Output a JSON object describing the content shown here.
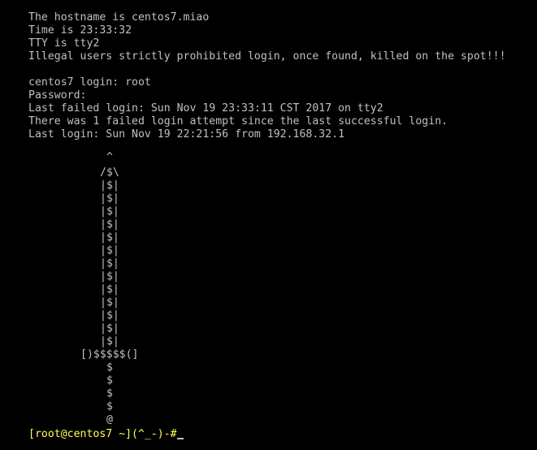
{
  "banner": {
    "hostname_line": "The hostname is centos7.miao",
    "time_line": "Time is 23:33:32",
    "tty_line": "TTY is tty2",
    "warning_line": "Illegal users strictly prohibited login, once found, killed on the spot!!!"
  },
  "login": {
    "login_line": "centos7 login: root",
    "password_line": "Password:",
    "last_failed_line": "Last failed login: Sun Nov 19 23:33:11 CST 2017 on tty2",
    "attempt_line": "There was 1 failed login attempt since the last successful login.",
    "last_login_line": "Last login: Sun Nov 19 22:21:56 from 192.168.32.1"
  },
  "ascii_art": {
    "tip": "^",
    "head": "/$\\",
    "shaft": "|$|",
    "guard": "[)$$$$$(]",
    "handle": "$",
    "pommel": "@"
  },
  "shell": {
    "prompt": "[root@centos7 ~](^_-)-#"
  },
  "colors": {
    "background": "#000000",
    "text": "#c0c0c0",
    "prompt": "#ffff55"
  }
}
